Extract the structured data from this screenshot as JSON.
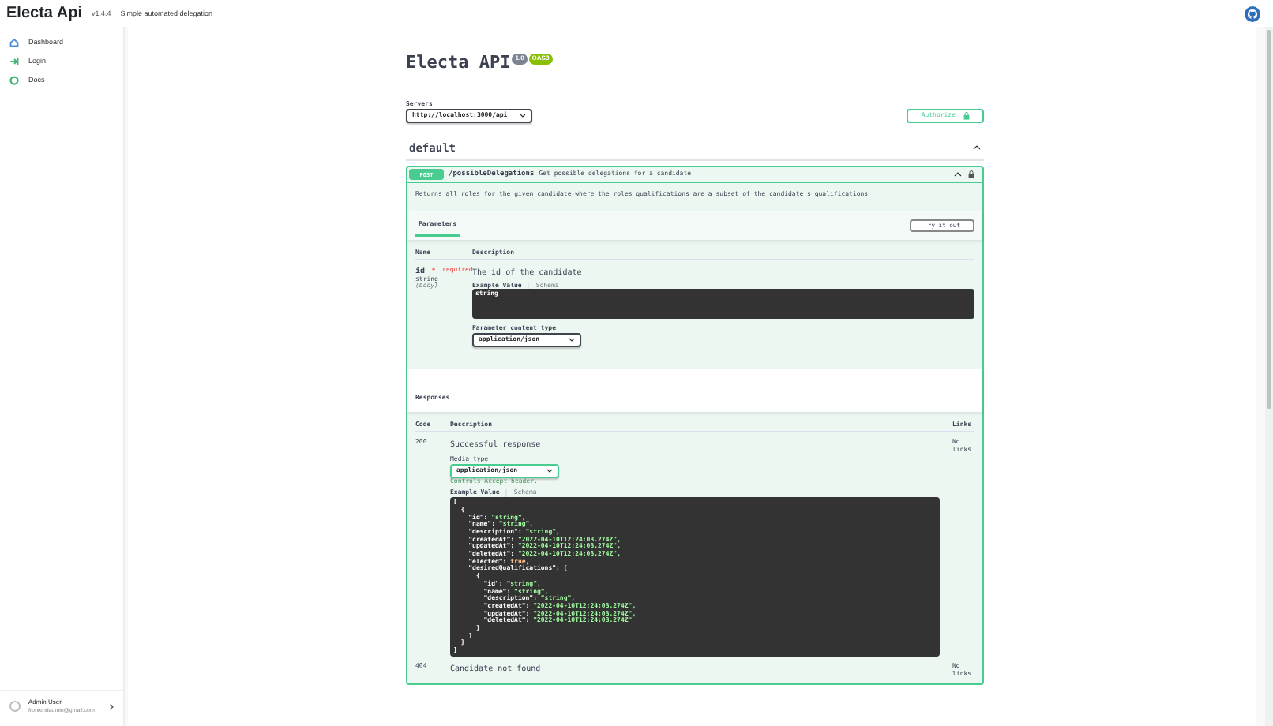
{
  "header": {
    "app_name": "Electa Api",
    "version": "v1.4.4",
    "tagline": "Simple automated delegation"
  },
  "sidebar": {
    "items": [
      {
        "label": "Dashboard",
        "selected": false,
        "color": "#4a90d9"
      },
      {
        "label": "Login",
        "selected": false,
        "color": "#3cb371"
      },
      {
        "label": "Docs",
        "selected": false,
        "color": "#3cb371"
      }
    ],
    "user": {
      "name": "Admin User",
      "email": "frontendadmin@gmail.com"
    }
  },
  "api": {
    "title": "Electa API",
    "version_badge": "1.0",
    "spec_badge": "OAS3",
    "servers_label": "Servers",
    "server": "http://localhost:3000/api",
    "authorize": "Authorize",
    "tag": {
      "name": "default",
      "expanded": true
    },
    "operation": {
      "method": "POST",
      "path": "/possibleDelegations",
      "summary": "Get possible delegations for a candidate",
      "expanded": true,
      "description": "Returns all roles for the given candidate where the roles qualifications are a subset of the candidate's qualifications",
      "parameters_tab": "Parameters",
      "try_button": "Try it out",
      "param_columns": [
        "Name",
        "Description"
      ],
      "param": {
        "name": "id",
        "required_mark": "*",
        "required": "required",
        "type": "string",
        "location": "(body)",
        "description": "The id of the candidate",
        "example_tab": "Example Value",
        "schema_tab": "Schema",
        "example_lines": [
          "string"
        ],
        "content_type_label": "Parameter content type",
        "content_type": "application/json"
      },
      "responses_title": "Responses",
      "response_columns": [
        "Code",
        "Description",
        "Links"
      ],
      "responses": [
        {
          "code": "200",
          "description": "Successful response",
          "links": "No links",
          "media_type_label": "Media type",
          "media_type": "application/json",
          "media_hint": "Controls Accept header.",
          "example_tab": "Example Value",
          "schema_tab": "Schema",
          "example_lines": [
            "[",
            "  {",
            "    \"id\": \"string\",",
            "    \"name\": \"string\",",
            "    \"description\": \"string\",",
            "    \"createdAt\": \"2022-04-10T12:24:03.274Z\",",
            "    \"updatedAt\": \"2022-04-10T12:24:03.274Z\",",
            "    \"deletedAt\": \"2022-04-10T12:24:03.274Z\",",
            "    \"elected\": true,",
            "    \"desiredQualifications\": [",
            "      {",
            "        \"id\": \"string\",",
            "        \"name\": \"string\",",
            "        \"description\": \"string\",",
            "        \"createdAt\": \"2022-04-10T12:24:03.274Z\",",
            "        \"updatedAt\": \"2022-04-10T12:24:03.274Z\",",
            "        \"deletedAt\": \"2022-04-10T12:24:03.274Z\"",
            "      }",
            "    ]",
            "  }",
            "]"
          ]
        },
        {
          "code": "404",
          "description": "Candidate not found",
          "links": "No links"
        }
      ]
    }
  }
}
